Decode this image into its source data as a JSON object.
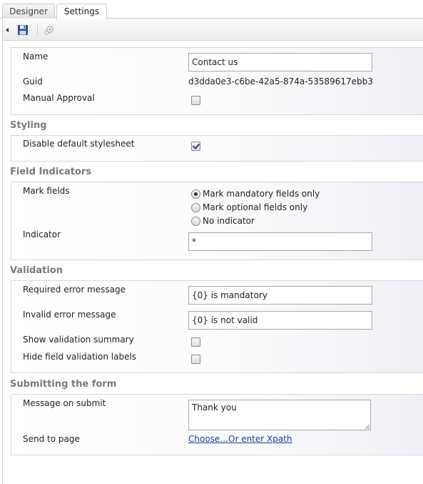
{
  "tabs": [
    {
      "label": "Designer",
      "active": false
    },
    {
      "label": "Settings",
      "active": true
    }
  ],
  "toolbar": {
    "collapse_icon": "triangle-left-icon",
    "save_icon": "floppy-disk-icon",
    "settings_icon": "gear-icon"
  },
  "general": {
    "name_label": "Name",
    "name_value": "Contact us",
    "guid_label": "Guid",
    "guid_value": "d3dda0e3-c6be-42a5-874a-53589617ebb3",
    "manual_approval_label": "Manual Approval",
    "manual_approval_checked": false
  },
  "styling": {
    "heading": "Styling",
    "disable_stylesheet_label": "Disable default stylesheet",
    "disable_stylesheet_checked": true
  },
  "field_indicators": {
    "heading": "Field Indicators",
    "mark_fields_label": "Mark fields",
    "options": [
      {
        "label": "Mark mandatory fields only",
        "selected": true
      },
      {
        "label": "Mark optional fields only",
        "selected": false
      },
      {
        "label": "No indicator",
        "selected": false
      }
    ],
    "indicator_label": "Indicator",
    "indicator_value": "*"
  },
  "validation": {
    "heading": "Validation",
    "required_label": "Required error message",
    "required_value": "{0} is mandatory",
    "invalid_label": "Invalid error message",
    "invalid_value": "{0} is not valid",
    "summary_label": "Show validation summary",
    "summary_checked": false,
    "hide_labels_label": "Hide field validation labels",
    "hide_labels_checked": false
  },
  "submitting": {
    "heading": "Submitting the form",
    "message_label": "Message on submit",
    "message_value": "Thank you",
    "send_label": "Send to page",
    "choose_link": "Choose...",
    "xpath_link": "Or enter Xpath"
  },
  "colors": {
    "link": "#1a3a9a",
    "section_heading": "#7a7a7a"
  }
}
